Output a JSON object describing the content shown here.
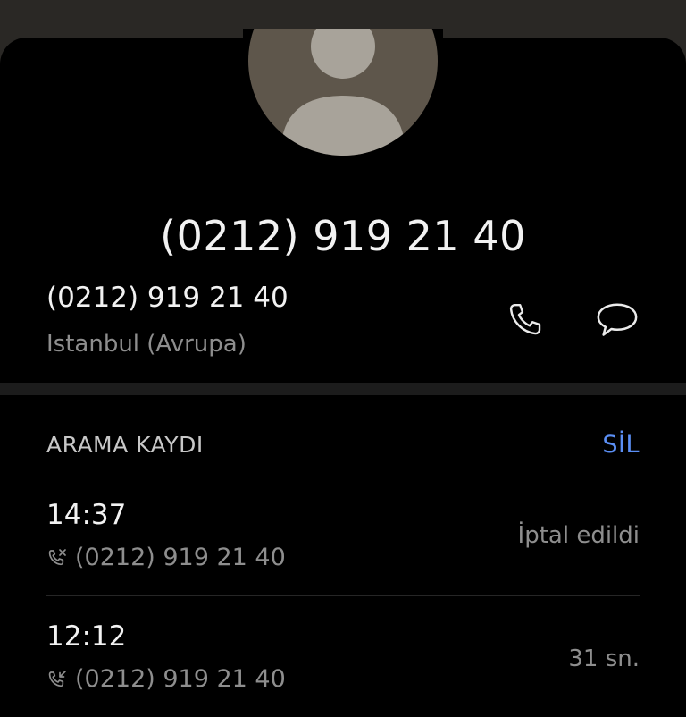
{
  "contact": {
    "title": "(0212) 919 21 40",
    "number": "(0212) 919 21 40",
    "location": "Istanbul (Avrupa)"
  },
  "icons": {
    "avatar": "person-placeholder-icon",
    "call": "phone-icon",
    "message": "chat-bubble-icon",
    "incoming": "incoming-call-icon",
    "outgoing": "outgoing-call-icon"
  },
  "call_log": {
    "title": "ARAMA KAYDI",
    "delete_label": "SİL",
    "entries": [
      {
        "time": "14:37",
        "number": "(0212) 919 21 40",
        "status": "İptal edildi"
      },
      {
        "time": "12:12",
        "number": "(0212) 919 21 40",
        "status": "31 sn."
      }
    ]
  },
  "colors": {
    "background": "#000000",
    "accent": "#5b8ff5",
    "avatar": "#5e564b",
    "muted_text": "#8e8e8e"
  }
}
